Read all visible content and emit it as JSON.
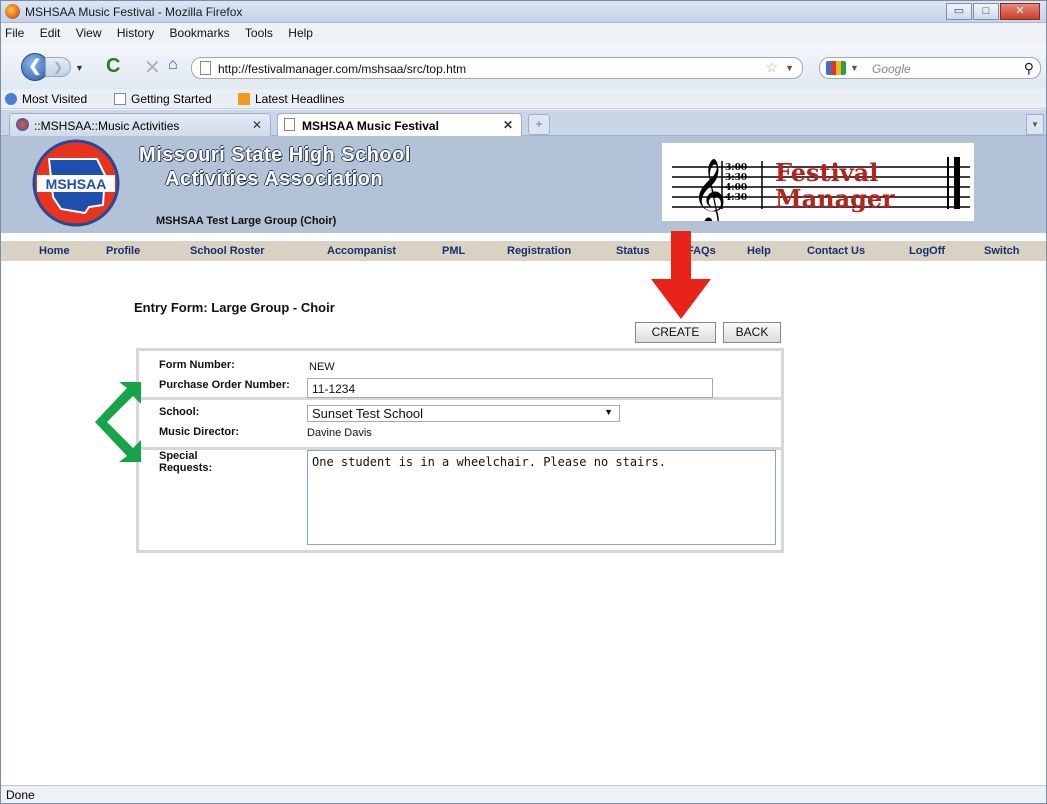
{
  "window": {
    "title": "MSHSAA Music Festival - Mozilla Firefox",
    "controls": {
      "minimize": "▭",
      "maximize": "□",
      "close": "✕"
    }
  },
  "menu": [
    "File",
    "Edit",
    "View",
    "History",
    "Bookmarks",
    "Tools",
    "Help"
  ],
  "navigation": {
    "url": "http://festivalmanager.com/mshsaa/src/top.htm",
    "search_placeholder": "Google"
  },
  "bookmarks": [
    "Most Visited",
    "Getting Started",
    "Latest Headlines"
  ],
  "tabs": [
    {
      "label": "::MSHSAA::Music Activities",
      "active": false
    },
    {
      "label": "MSHSAA Music Festival",
      "active": true
    }
  ],
  "header": {
    "logo_text": "MSHSAA",
    "org_line1": "Missouri State High School",
    "org_line2": "Activities Association",
    "subgroup": "MSHSAA Test Large Group (Choir)",
    "festival_line1": "Festival",
    "festival_line2": "Manager",
    "times": [
      "3:00",
      "3:30",
      "4:00",
      "4:30"
    ]
  },
  "nav_tabs": [
    "Home",
    "Profile",
    "School Roster",
    "Accompanist",
    "PML",
    "Registration",
    "Status",
    "FAQs",
    "Help",
    "Contact Us",
    "LogOff",
    "Switch"
  ],
  "form": {
    "title": "Entry Form: Large Group - Choir",
    "create_label": "CREATE",
    "back_label": "BACK",
    "form_number_label": "Form Number:",
    "form_number_value": "NEW",
    "po_label": "Purchase Order Number:",
    "po_value": "11-1234",
    "school_label": "School:",
    "school_value": "Sunset Test School",
    "director_label": "Music Director:",
    "director_value": "Davine Davis",
    "requests_label_1": "Special",
    "requests_label_2": "Requests:",
    "requests_value": "One student is in a wheelchair.  Please no stairs."
  },
  "status": "Done",
  "colors": {
    "header_bg": "#b3c2d7",
    "nav_bg": "#d8d2c2",
    "red_arrow": "#e8231a",
    "green_arrow": "#17a34a",
    "brand_red": "#b5231d"
  }
}
